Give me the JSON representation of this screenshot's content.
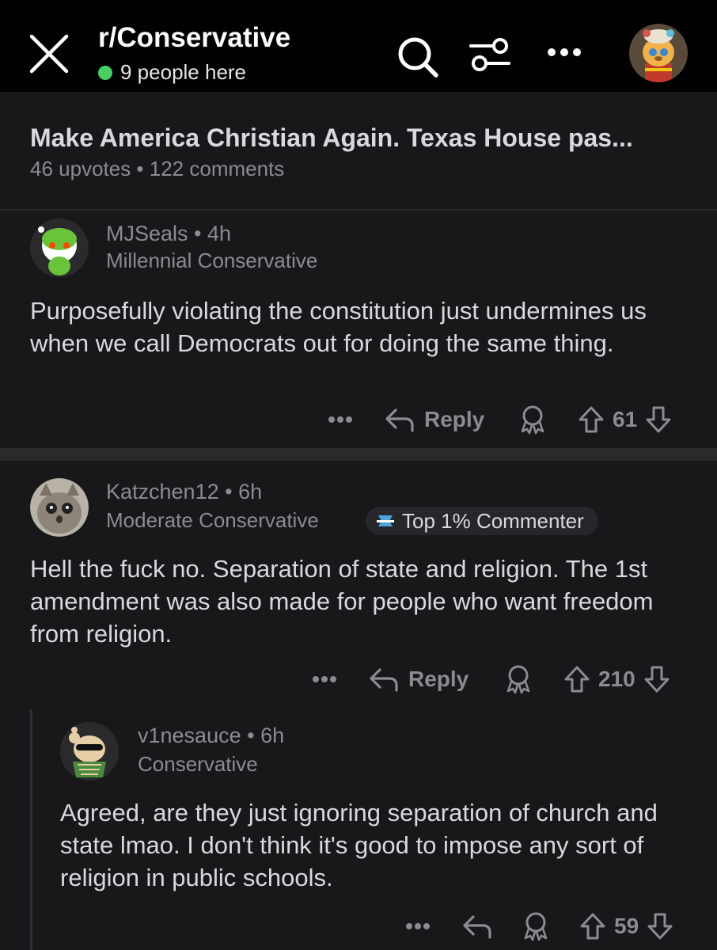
{
  "topbar": {
    "subreddit": "r/Conservative",
    "presence": "9 people here",
    "online_color": "#46d160",
    "icons": [
      "close-icon",
      "search-icon",
      "filter-icon",
      "more-icon"
    ]
  },
  "post": {
    "title": "Make America Christian Again. Texas House pas...",
    "meta": "46 upvotes • 122 comments"
  },
  "comments": [
    {
      "author": "MJSeals",
      "time": "4h",
      "flair": "Millennial Conservative",
      "body": "Purposefully violating the constitution just undermines us when we call Democrats out for doing the same thing.",
      "reply_label": "Reply",
      "score": "61"
    },
    {
      "author": "Katzchen12",
      "time": "6h",
      "flair": "Moderate Conservative",
      "badge": "Top 1% Commenter",
      "body": "Hell the fuck no. Separation of state and religion. The 1st amendment was also made for people who want freedom from religion.",
      "reply_label": "Reply",
      "score": "210"
    },
    {
      "author": "v1nesauce",
      "time": "6h",
      "flair": "Conservative",
      "body": "Agreed, are they just ignoring separation of church and state lmao. I don't think it's good to impose any sort of religion in public schools.",
      "score": "59"
    }
  ]
}
